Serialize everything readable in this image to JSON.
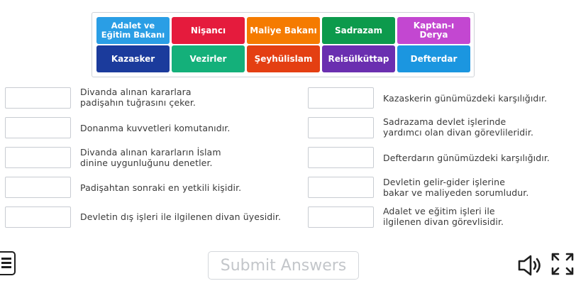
{
  "tiles": [
    {
      "label": "Adalet ve\nEğitim Bakanı",
      "color": "#2a9ee5"
    },
    {
      "label": "Nişancı",
      "color": "#e51b3d"
    },
    {
      "label": "Maliye Bakanı",
      "color": "#f57b00"
    },
    {
      "label": "Sadrazam",
      "color": "#0c9a4c"
    },
    {
      "label": "Kaptan-ı Derya",
      "color": "#c347d1"
    },
    {
      "label": "Kazasker",
      "color": "#1b3b9c"
    },
    {
      "label": "Vezirler",
      "color": "#14b07a"
    },
    {
      "label": "Şeyhülislam",
      "color": "#e43f12"
    },
    {
      "label": "Reisülküttap",
      "color": "#6a2fb0"
    },
    {
      "label": "Defterdar",
      "color": "#1b96e0"
    }
  ],
  "clues_left": [
    "Divanda alınan kararlara\npadişahın tuğrasını çeker.",
    "Donanma kuvvetleri komutanıdır.",
    "Divanda alınan kararların İslam\ndinine uygunluğunu denetler.",
    "Padişahtan sonraki en yetkili kişidir.",
    "Devletin dış işleri ile ilgilenen divan üyesidir."
  ],
  "clues_right": [
    "Kazaskerin günümüzdeki karşılığıdır.",
    "Sadrazama devlet işlerinde\nyardımcı olan divan görevlileridir.",
    "Defterdarın günümüzdeki karşılığıdır.",
    "Devletin gelir-gider işlerine\nbakar ve maliyeden sorumludur.",
    "Adalet ve eğitim işleri ile\nilgilenen divan görevlisidir."
  ],
  "submit_label": "Submit Answers",
  "icons": {
    "menu": "menu-icon",
    "sound": "speaker-icon",
    "fullscreen": "fullscreen-icon"
  }
}
